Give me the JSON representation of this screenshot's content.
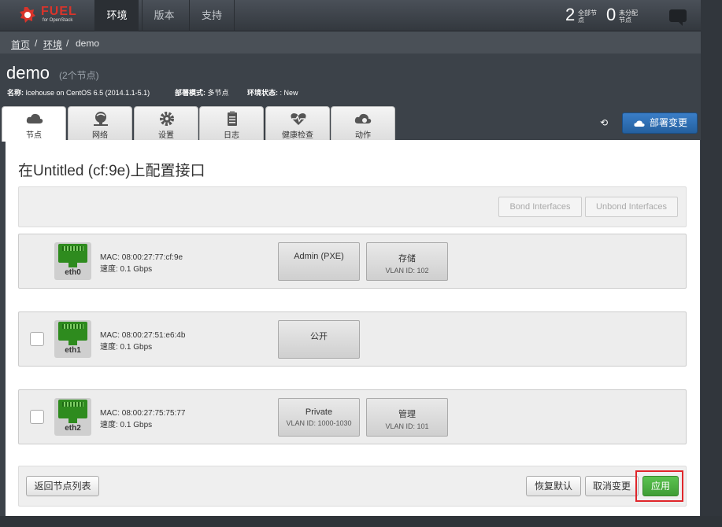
{
  "brand": {
    "name": "FUEL",
    "sub": "for OpenStack"
  },
  "nav": {
    "tabs": [
      "环境",
      "版本",
      "支持"
    ],
    "active": 0
  },
  "stats": [
    {
      "num": "2",
      "label": "全部节点"
    },
    {
      "num": "0",
      "label": "未分配节点"
    }
  ],
  "breadcrumb": {
    "home": "首页",
    "env": "环境",
    "current": "demo",
    "sep": "/"
  },
  "env": {
    "name": "demo",
    "count": "(2个节点)",
    "meta_name_label": "名称:",
    "meta_name": "Icehouse on CentOS 6.5 (2014.1.1-5.1)",
    "meta_mode_label": "部署模式:",
    "meta_mode": "多节点",
    "meta_status_label": "环境状态:",
    "meta_status": ": New"
  },
  "tabs": [
    {
      "label": "节点",
      "icon": "cloud-icon"
    },
    {
      "label": "网络",
      "icon": "network-icon"
    },
    {
      "label": "设置",
      "icon": "gear-icon"
    },
    {
      "label": "日志",
      "icon": "clipboard-icon"
    },
    {
      "label": "健康检查",
      "icon": "heart-icon"
    },
    {
      "label": "动作",
      "icon": "cloud-gear-icon"
    }
  ],
  "deploy": {
    "label": "部署变更",
    "history_icon": "history-icon"
  },
  "panel": {
    "title": "在Untitled (cf:9e)上配置接口",
    "bond_label": "Bond Interfaces",
    "unbond_label": "Unbond Interfaces"
  },
  "interfaces": [
    {
      "name": "eth0",
      "mac": "MAC: 08:00:27:77:cf:9e",
      "speed": "速度: 0.1 Gbps",
      "networks": [
        {
          "name": "Admin (PXE)",
          "vlan": ""
        },
        {
          "name": "存储",
          "vlan": "VLAN ID: 102"
        }
      ]
    },
    {
      "name": "eth1",
      "mac": "MAC: 08:00:27:51:e6:4b",
      "speed": "速度: 0.1 Gbps",
      "networks": [
        {
          "name": "公开",
          "vlan": ""
        }
      ]
    },
    {
      "name": "eth2",
      "mac": "MAC: 08:00:27:75:75:77",
      "speed": "速度: 0.1 Gbps",
      "networks": [
        {
          "name": "Private",
          "vlan": "VLAN ID: 1000-1030"
        },
        {
          "name": "管理",
          "vlan": "VLAN ID: 101"
        }
      ]
    }
  ],
  "footer": {
    "back": "返回节点列表",
    "restore": "恢复默认",
    "cancel": "取消变更",
    "apply": "应用"
  },
  "colors": {
    "accent_blue": "#2f6fb3",
    "apply_green": "#4cb043",
    "highlight_red": "#e0262b",
    "brand_red": "#d9342b"
  }
}
